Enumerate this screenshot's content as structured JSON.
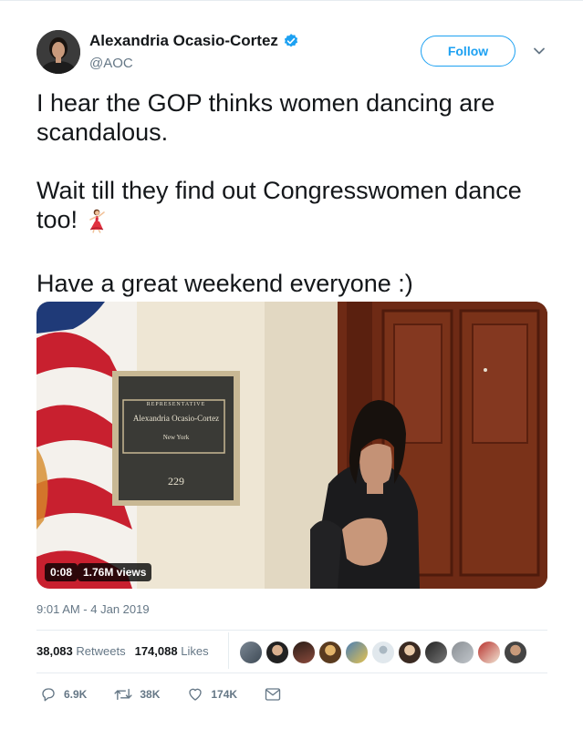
{
  "author": {
    "name": "Alexandria Ocasio-Cortez",
    "handle": "@AOC",
    "verified": true
  },
  "follow_label": "Follow",
  "tweet": {
    "line1": "I hear the GOP thinks women dancing are scandalous.",
    "line2": "Wait till they find out Congresswomen dance too!",
    "line3": "Have a great weekend everyone :)"
  },
  "media": {
    "plaque_title": "REPRESENTATIVE",
    "plaque_name": "Alexandria Ocasio-Cortez",
    "plaque_state": "New York",
    "plaque_room": "229",
    "duration": "0:08",
    "views": "1.76M views"
  },
  "timestamp": "9:01 AM - 4 Jan 2019",
  "stats": {
    "retweets_count": "38,083",
    "retweets_label": "Retweets",
    "likes_count": "174,088",
    "likes_label": "Likes"
  },
  "actions": {
    "replies": "6.9K",
    "retweets": "38K",
    "likes": "174K"
  },
  "colors": {
    "accent": "#1da1f2",
    "verified": "#1da1f2",
    "secondary_text": "#657786"
  },
  "icons": {
    "verified": "verified-badge-icon",
    "caret": "chevron-down-icon",
    "reply": "reply-icon",
    "retweet": "retweet-icon",
    "like": "heart-icon",
    "dm": "envelope-icon",
    "emoji": "dancing-woman-emoji"
  }
}
